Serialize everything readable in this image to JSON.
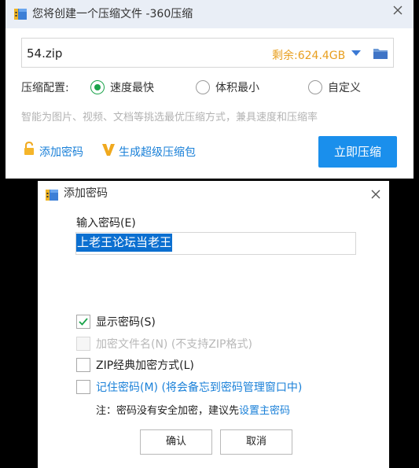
{
  "top_window": {
    "title": "您将创建一个压缩文件 -360压缩",
    "filename": "54.zip",
    "space_left": "剩余:624.4GB",
    "config_label": "压缩配置:",
    "options": [
      "速度最快",
      "体积最小",
      "自定义"
    ],
    "hint": "智能为图片、视频、文档等挑选最优压缩方式，兼具速度和压缩率",
    "add_password": "添加密码",
    "super_package": "生成超级压缩包",
    "compress_now": "立即压缩"
  },
  "dialog": {
    "title": "添加密码",
    "password_label": "输入密码(E)",
    "password_value": "上老王论坛当老王",
    "show_password": "显示密码(S)",
    "encrypt_filename": "加密文件名(N) (不支持ZIP格式)",
    "zip_classic": "ZIP经典加密方式(L)",
    "remember_password": "记住密码(M) (将会备忘到密码管理窗口中)",
    "note_prefix": "注：密码没有安全加密，建议先",
    "set_master_password": "设置主密码",
    "ok": "确认",
    "cancel": "取消"
  },
  "colors": {
    "accent": "#1a8fec",
    "orange": "#e89f1f",
    "link": "#1a80d8",
    "green": "#1aa34a"
  }
}
